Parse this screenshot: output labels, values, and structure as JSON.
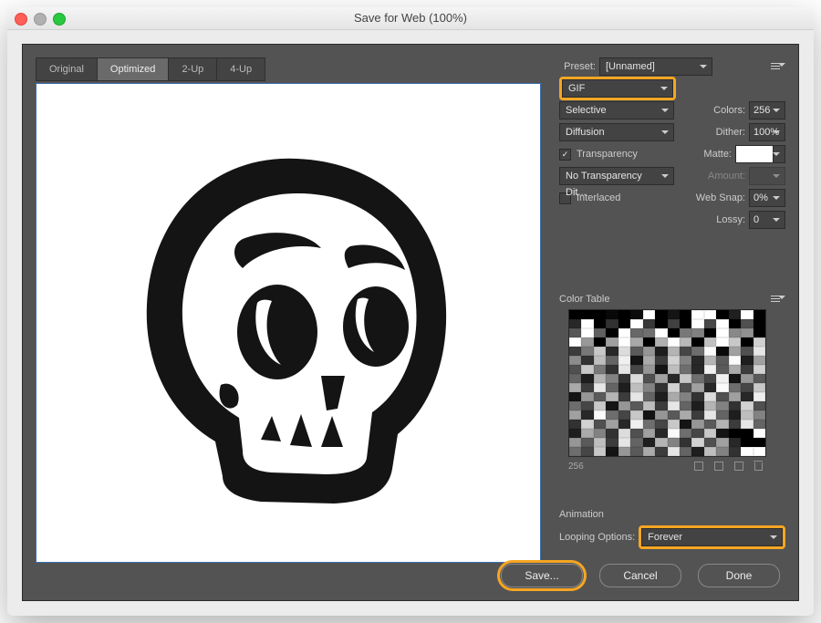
{
  "window": {
    "title": "Save for Web (100%)"
  },
  "tabs": [
    "Original",
    "Optimized",
    "2-Up",
    "4-Up"
  ],
  "active_tab": "Optimized",
  "preset": {
    "label": "Preset:",
    "value": "[Unnamed]"
  },
  "format": {
    "value": "GIF"
  },
  "reduction": {
    "value": "Selective"
  },
  "dither_algo": {
    "value": "Diffusion"
  },
  "colors": {
    "label": "Colors:",
    "value": "256"
  },
  "dither": {
    "label": "Dither:",
    "value": "100%"
  },
  "transparency": {
    "label": "Transparency",
    "checked": true
  },
  "matte": {
    "label": "Matte:"
  },
  "trans_dither": {
    "value": "No Transparency Dit..."
  },
  "amount": {
    "label": "Amount:"
  },
  "interlaced": {
    "label": "Interlaced",
    "checked": false
  },
  "websnap": {
    "label": "Web Snap:",
    "value": "0%"
  },
  "lossy": {
    "label": "Lossy:",
    "value": "0"
  },
  "color_table": {
    "title": "Color Table",
    "count": "256"
  },
  "animation": {
    "title": "Animation",
    "looping_label": "Looping Options:",
    "looping_value": "Forever"
  },
  "buttons": {
    "save": "Save...",
    "cancel": "Cancel",
    "done": "Done"
  }
}
